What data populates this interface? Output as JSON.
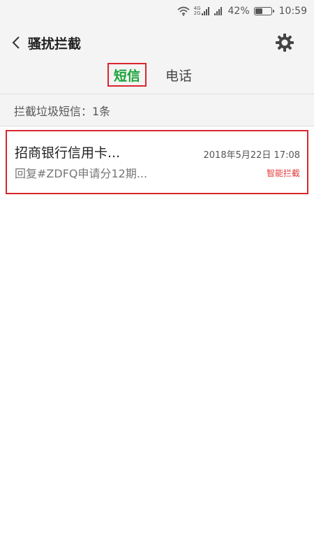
{
  "status_bar": {
    "net_top": "4G",
    "net_bottom": "2G",
    "battery": "42%",
    "battery_level": 0.42,
    "time": "10:59"
  },
  "header": {
    "title": "骚扰拦截"
  },
  "tabs": [
    {
      "label": "短信",
      "active": true
    },
    {
      "label": "电话",
      "active": false
    }
  ],
  "summary": {
    "text": "拦截垃圾短信：1条"
  },
  "messages": [
    {
      "sender": "招商银行信用卡...",
      "date": "2018年5月22日 17:08",
      "preview": "回复#ZDFQ申请分12期...",
      "tag": "智能拦截"
    }
  ],
  "colors": {
    "accent": "#1aa33a",
    "highlight_border": "#d9262e",
    "tag": "#e23b3b",
    "background": "#f4f4f4"
  }
}
